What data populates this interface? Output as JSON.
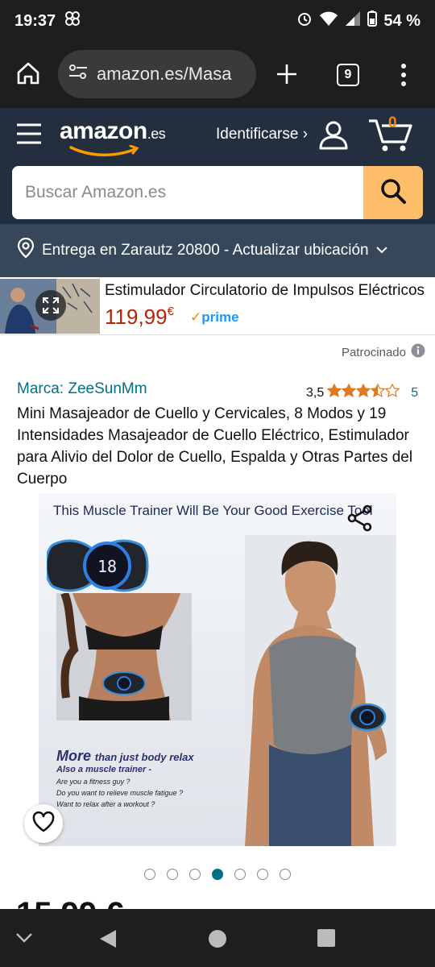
{
  "statusbar": {
    "time": "19:37",
    "battery": "54 %"
  },
  "browser": {
    "url": "amazon.es/Masa",
    "tab_count": "9"
  },
  "header": {
    "logo_text": "amazon",
    "logo_suffix": ".es",
    "signin": "Identificarse ›",
    "cart_count": "0"
  },
  "search": {
    "placeholder": "Buscar Amazon.es"
  },
  "delivery": {
    "text": "Entrega en Zarautz 20800 - Actualizar ubicación"
  },
  "ad": {
    "title": "Estimulador Circulatorio de Impulsos Eléctricos",
    "price": "119,99",
    "currency": "€",
    "prime_label": "prime"
  },
  "sponsored": {
    "label": "Patrocinado"
  },
  "product": {
    "brand": "Marca: ZeeSunMm",
    "rating_value": "3,5",
    "rating": 3.5,
    "rating_count": "5",
    "title": "Mini Masajeador de Cuello y Cervicales, 8 Modos y 19 Intensidades Masajeador de Cuello Eléctrico, Estimulador para Alivio del Dolor de Cuello, Espalda y Otras Partes del Cuerpo"
  },
  "image": {
    "headline": "This Muscle Trainer Will Be Your Good Exercise Tool",
    "more_text": "More",
    "more_rest": "than just body relax",
    "sub": "Also a muscle trainer -",
    "q1": "Are you a fitness guy ?",
    "q2": "Do you want to relieve muscle fatigue ?",
    "q3": "Want to relax after a workout ?",
    "device_display": "18"
  },
  "carousel": {
    "total": 7,
    "active_index": 3
  },
  "price_peek": {
    "text": "15,99 €"
  },
  "colors": {
    "amazon_dark": "#232f3e",
    "delivery_bar": "#37475a",
    "search_button": "#febd69",
    "link": "#007185",
    "price_red": "#b12704",
    "star": "#de7921"
  }
}
